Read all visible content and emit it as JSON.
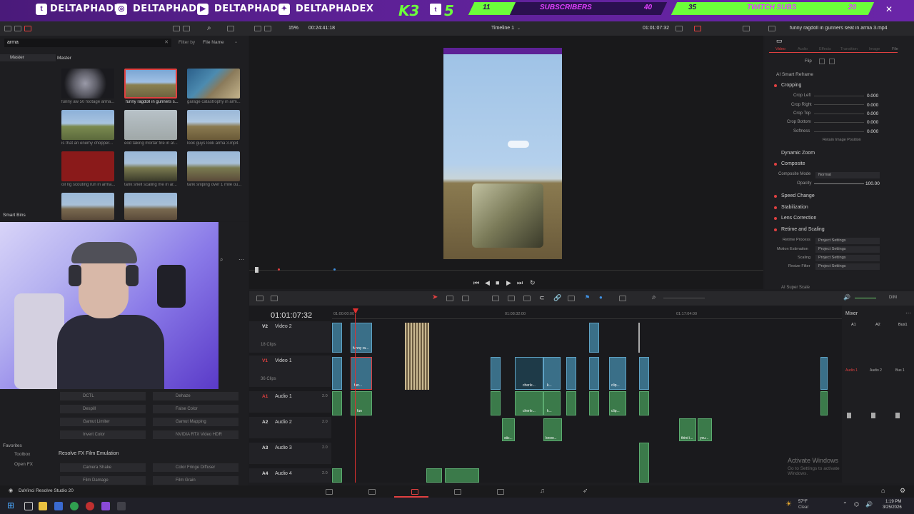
{
  "banner": {
    "handles": [
      "DELTAPHADE",
      "DELTAPHADE",
      "DELTAPHADE",
      "DELTAPHADEX"
    ],
    "logo_text": "K3",
    "logo_num": "5",
    "subs_current": "11",
    "subs_label": "SUBSCRIBERS",
    "subs_goal": "40",
    "twitch_current": "35",
    "twitch_label": "TWITCH SUBS",
    "twitch_goal": "20"
  },
  "media_pool": {
    "search_value": "arma",
    "filter_by": "Filter by",
    "filter_value": "File Name",
    "bin_master": "Master",
    "pool_master": "Master",
    "smart_bins": "Smart Bins",
    "clips": [
      "funny aw 50 footage arma...",
      "funny ragdoll in gunners s...",
      "garage catastrophy in arm...",
      "is that an enemy chopper...",
      "eod taking mortar fire in ar...",
      "look guys look arma 3.mp4",
      "oil rig scouting run in arma...",
      "tank shell scaling me in ar...",
      "tank sniping over 1 mile ou..."
    ]
  },
  "viewer": {
    "zoom": "15%",
    "timecode_left": "00:24:41:18",
    "timeline_name": "Timeline 1",
    "timecode_right": "01:01:07:32",
    "clip_title": "funny ragdoll in gunners seat in arma 3.mp4"
  },
  "inspector": {
    "tab_video": "Video",
    "tab_audio": "Audio",
    "tab_effects": "Effects",
    "tab_transition": "Transition",
    "tab_image": "Image",
    "tab_file": "File",
    "flip": "Flip",
    "ai_reframe": "AI Smart Reframe",
    "cropping": "Cropping",
    "crop_left": "Crop Left",
    "crop_right": "Crop Right",
    "crop_top": "Crop Top",
    "crop_bottom": "Crop Bottom",
    "softness": "Softness",
    "crop_left_val": "0.000",
    "crop_right_val": "0.000",
    "crop_top_val": "0.000",
    "crop_bottom_val": "0.000",
    "softness_val": "0.000",
    "retain": "Retain Image Position",
    "dynamic_zoom": "Dynamic Zoom",
    "composite": "Composite",
    "composite_mode": "Composite Mode",
    "composite_mode_val": "Normal",
    "opacity": "Opacity",
    "opacity_val": "100.00",
    "speed_change": "Speed Change",
    "stabilization": "Stabilization",
    "lens_correction": "Lens Correction",
    "retime_scaling": "Retime and Scaling",
    "retime_process": "Retime Process",
    "motion_estimation": "Motion Estimation",
    "scaling": "Scaling",
    "resize_filter": "Resize Filter",
    "project_settings": "Project Settings",
    "ai_super_scale": "AI Super Scale"
  },
  "timeline": {
    "timecode": "01:01:07:32",
    "ruler": [
      "01:00:00:00",
      "01:08:32:00",
      "01:17:04:00"
    ],
    "tracks": [
      {
        "num": "V2",
        "name": "Video 2",
        "clips": "18 Clips"
      },
      {
        "num": "V1",
        "name": "Video 1",
        "clips": "36 Clips"
      },
      {
        "num": "A1",
        "name": "Audio 1",
        "level": "2.0"
      },
      {
        "num": "A2",
        "name": "Audio 2",
        "level": "2.0"
      },
      {
        "num": "A3",
        "name": "Audio 3",
        "level": "2.0"
      },
      {
        "num": "A4",
        "name": "Audio 4",
        "level": "2.0"
      }
    ],
    "clip_labels": {
      "v2_a": "funny ra...",
      "v1_a": "fun...",
      "v1_b": "cherle...",
      "v1_c": "k...",
      "v1_d": "clip...",
      "a1_a": "fun",
      "a1_b": "cherle...",
      "a1_c": "k...",
      "a1_d": "clip...",
      "a2_a": "stic...",
      "a2_b": "know...",
      "a2_c": "third i...",
      "a2_d": "you..."
    }
  },
  "mixer": {
    "title": "Mixer",
    "cols": [
      "A1",
      "A2",
      "Bus1"
    ],
    "labels": [
      "Audio 1",
      "Audio 2",
      "Bus 1"
    ],
    "dim": "DIM"
  },
  "effects": {
    "favorites": "Favorites",
    "toolbox": "Toolbox",
    "open_fx": "Open FX",
    "film_emulation": "Resolve FX Film Emulation",
    "items": [
      "DCTL",
      "Dehaze",
      "Despill",
      "False Color",
      "Gamut Limiter",
      "Gamut Mapping",
      "Invert Color",
      "NVIDIA RTX Video HDR",
      "Camera Shake",
      "Color Fringe Diffuser",
      "Film Damage",
      "Film Grain"
    ]
  },
  "status": {
    "app_name": "DaVinci Resolve Studio 20",
    "activate": "Activate Windows",
    "activate_sub": "Go to Settings to activate Windows."
  },
  "taskbar": {
    "temp": "57°F",
    "weather": "Clear",
    "time": "1:19 PM",
    "date": "3/25/2026"
  },
  "colors": {
    "accent_red": "#e04040",
    "playhead": "#e03030",
    "video_clip": "#3a6f88",
    "audio_clip": "#3b7a4a",
    "banner": "#5d2196"
  }
}
